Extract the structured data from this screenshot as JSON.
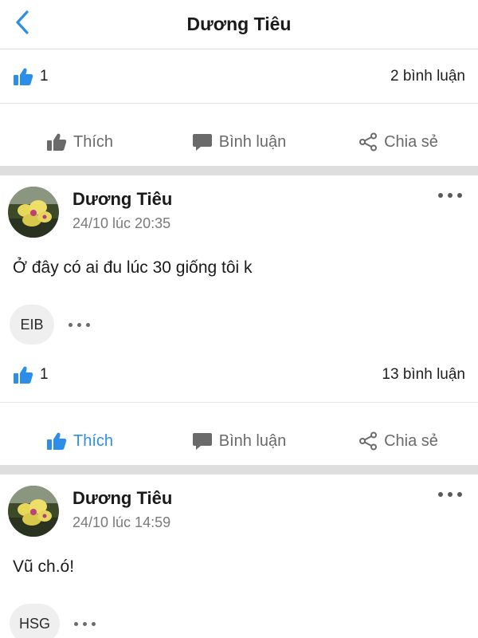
{
  "header": {
    "title": "Dương Tiêu"
  },
  "accent_color": "#2c8ee8",
  "top_section": {
    "likes": "1",
    "comments": "2 bình luận",
    "actions": {
      "like": "Thích",
      "comment": "Bình luận",
      "share": "Chia sẻ"
    }
  },
  "posts": [
    {
      "author": "Dương Tiêu",
      "timestamp": "24/10 lúc 20:35",
      "content": "Ở đây có ai đu lúc 30 giống tôi k",
      "tag": "EIB",
      "likes": "1",
      "comments": "13 bình luận",
      "liked": true,
      "actions": {
        "like": "Thích",
        "comment": "Bình luận",
        "share": "Chia sẻ"
      }
    },
    {
      "author": "Dương Tiêu",
      "timestamp": "24/10 lúc 14:59",
      "content": "Vũ ch.ó!",
      "tag": "HSG"
    }
  ]
}
